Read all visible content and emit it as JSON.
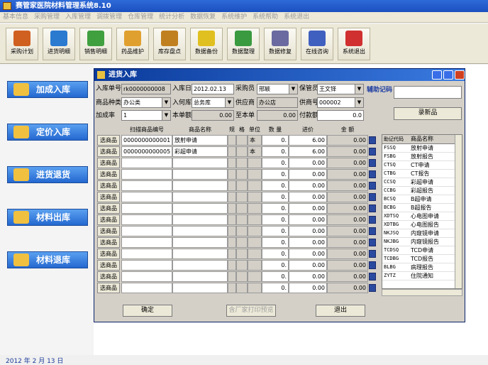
{
  "app": {
    "title": "赛管家医院材料管理系统8.10"
  },
  "menu": [
    "基本信息",
    "采购管理",
    "入库管理",
    "调拨管理",
    "仓库管理",
    "统计分析",
    "数据恢复",
    "系统维护",
    "系统帮助",
    "系统退出"
  ],
  "toolbar": [
    {
      "label": "采购计划",
      "icon": "purchase-plan-icon"
    },
    {
      "label": "进货明细",
      "icon": "stock-detail-icon"
    },
    {
      "label": "销售明细",
      "icon": "sales-detail-icon"
    },
    {
      "label": "药品维护",
      "icon": "drug-maintain-icon"
    },
    {
      "label": "库存盘点",
      "icon": "inventory-count-icon"
    },
    {
      "label": "数据备份",
      "icon": "data-backup-icon"
    },
    {
      "label": "数据整理",
      "icon": "data-tidy-icon"
    },
    {
      "label": "数据修复",
      "icon": "data-repair-icon"
    },
    {
      "label": "在线咨询",
      "icon": "online-consult-icon"
    },
    {
      "label": "系统退出",
      "icon": "system-exit-icon"
    }
  ],
  "left": {
    "buttons": [
      "加成入库",
      "定价入库",
      "进货退货",
      "材料出库",
      "材料退库"
    ],
    "date": "2012 年   2 月 13 日"
  },
  "dialog": {
    "title": "进货入库",
    "labels": {
      "doc_no": "入库单号",
      "in_date": "入库日",
      "buyer": "采购员",
      "keeper": "保管员",
      "aux_code": "辅助记码",
      "category": "商品种类",
      "warehouse": "入何库",
      "supplier": "供应商",
      "supplier_no": "供商号",
      "markup": "加成率",
      "cost_total": "本单额",
      "invoice_total": "至本单",
      "pay_amount": "付款额"
    },
    "values": {
      "doc_no": "rk0000000008",
      "in_date": "2012.02.13",
      "buyer": "邢颖",
      "keeper": "王文铎",
      "aux_code": "",
      "category": "办公类",
      "warehouse": "总务库",
      "supplier": "办公店",
      "supplier_no": "000002",
      "markup": "1",
      "cost_total": "0.00",
      "invoice_total": "0.00",
      "pay_amount": "0.0"
    },
    "new_item_button": "录新品",
    "grid": {
      "headers": [
        "扫描商品编号",
        "商品名称",
        "规",
        "格",
        "单位",
        "数 量",
        "进价",
        "金 额"
      ],
      "select_label": "选商品",
      "rows": [
        {
          "code": "0000000000001",
          "name": "放射申请",
          "unit": "本",
          "qty": "0.",
          "price": "6.00",
          "amount": "0.00"
        },
        {
          "code": "0000000000005",
          "name": "彩超申请",
          "unit": "本",
          "qty": "0.",
          "price": "6.00",
          "amount": "0.00"
        },
        {
          "code": "",
          "name": "",
          "unit": "",
          "qty": "0.",
          "price": "0.00",
          "amount": "0.00"
        },
        {
          "code": "",
          "name": "",
          "unit": "",
          "qty": "0.",
          "price": "0.00",
          "amount": "0.00"
        },
        {
          "code": "",
          "name": "",
          "unit": "",
          "qty": "0.",
          "price": "0.00",
          "amount": "0.00"
        },
        {
          "code": "",
          "name": "",
          "unit": "",
          "qty": "0.",
          "price": "0.00",
          "amount": "0.00"
        },
        {
          "code": "",
          "name": "",
          "unit": "",
          "qty": "0.",
          "price": "0.00",
          "amount": "0.00"
        },
        {
          "code": "",
          "name": "",
          "unit": "",
          "qty": "0.",
          "price": "0.00",
          "amount": "0.00"
        },
        {
          "code": "",
          "name": "",
          "unit": "",
          "qty": "0.",
          "price": "0.00",
          "amount": "0.00"
        },
        {
          "code": "",
          "name": "",
          "unit": "",
          "qty": "0.",
          "price": "0.00",
          "amount": "0.00"
        },
        {
          "code": "",
          "name": "",
          "unit": "",
          "qty": "0.",
          "price": "0.00",
          "amount": "0.00"
        },
        {
          "code": "",
          "name": "",
          "unit": "",
          "qty": "0.",
          "price": "0.00",
          "amount": "0.00"
        },
        {
          "code": "",
          "name": "",
          "unit": "",
          "qty": "0.",
          "price": "0.00",
          "amount": "0.00"
        },
        {
          "code": "",
          "name": "",
          "unit": "",
          "qty": "0.",
          "price": "0.00",
          "amount": "0.00"
        }
      ]
    },
    "side": {
      "headers": [
        "助记代码",
        "商品名称"
      ],
      "rows": [
        [
          "FSSQ",
          "放射申请"
        ],
        [
          "FSBG",
          "放射报告"
        ],
        [
          "CTSQ",
          "CT申请"
        ],
        [
          "CTBG",
          "CT报告"
        ],
        [
          "CCSQ",
          "彩超申请"
        ],
        [
          "CCBG",
          "彩超报告"
        ],
        [
          "BCSQ",
          "B超申请"
        ],
        [
          "BCBG",
          "B超报告"
        ],
        [
          "XDTSQ",
          "心电图申请"
        ],
        [
          "XDTBG",
          "心电图报告"
        ],
        [
          "NKJSQ",
          "内窥镜申请"
        ],
        [
          "NKJBG",
          "内窥镜报告"
        ],
        [
          "TCDSQ",
          "TCD申请"
        ],
        [
          "TCDBG",
          "TCD报告"
        ],
        [
          "BLBG",
          "病理报告"
        ],
        [
          "ZYTZ",
          "住院通知"
        ]
      ]
    },
    "buttons": {
      "ok": "确定",
      "print": "含厂家打印预览",
      "exit": "退出"
    }
  }
}
